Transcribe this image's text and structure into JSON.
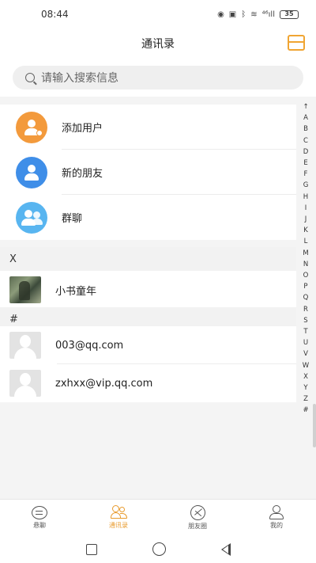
{
  "status": {
    "time": "08:44",
    "signal": "⁴⁶ıll",
    "battery": "35"
  },
  "header": {
    "title": "通讯录"
  },
  "search": {
    "placeholder": "请输入搜索信息"
  },
  "functions": [
    {
      "label": "添加用户",
      "color": "#f39a3c"
    },
    {
      "label": "新的朋友",
      "color": "#3f8ee8"
    },
    {
      "label": "群聊",
      "color": "#58b5f0"
    }
  ],
  "sections": [
    {
      "letter": "X",
      "contacts": [
        {
          "name": "小书童年",
          "avatar": "photo"
        }
      ]
    },
    {
      "letter": "#",
      "contacts": [
        {
          "name": "003@qq.com",
          "avatar": "default"
        },
        {
          "name": "zxhxx@vip.qq.com",
          "avatar": "default"
        }
      ]
    }
  ],
  "index": [
    "↑",
    "A",
    "B",
    "C",
    "D",
    "E",
    "F",
    "G",
    "H",
    "I",
    "J",
    "K",
    "L",
    "M",
    "N",
    "O",
    "P",
    "Q",
    "R",
    "S",
    "T",
    "U",
    "V",
    "W",
    "X",
    "Y",
    "Z",
    "#"
  ],
  "tabs": [
    {
      "label": "悬聊",
      "icon": "chat-icon",
      "active": false
    },
    {
      "label": "通讯录",
      "icon": "contacts-icon",
      "active": true
    },
    {
      "label": "朋友圈",
      "icon": "moments-icon",
      "active": false
    },
    {
      "label": "我的",
      "icon": "me-icon",
      "active": false
    }
  ],
  "colors": {
    "accent": "#e89b2e"
  }
}
